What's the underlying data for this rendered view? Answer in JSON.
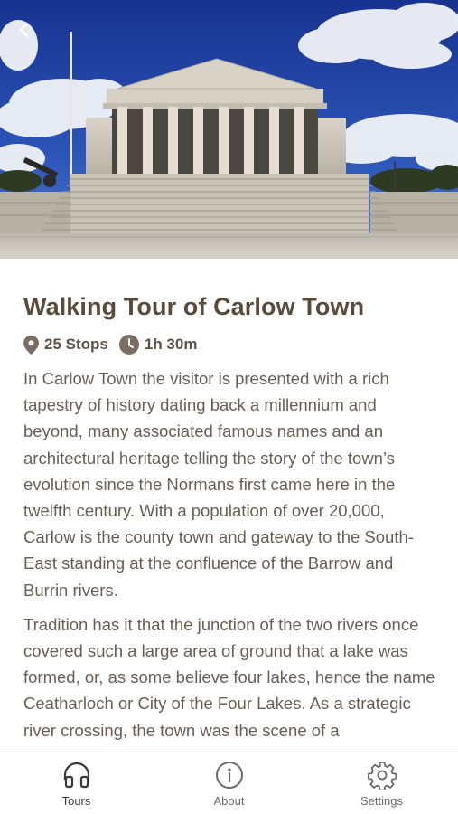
{
  "header": {
    "back_icon": "chevron-left-icon",
    "hero_image": "neoclassical-courthouse-photo"
  },
  "tour": {
    "title": "Walking Tour of Carlow Town",
    "stops": "25 Stops",
    "duration": "1h 30m",
    "stops_icon": "map-pin-icon",
    "duration_icon": "clock-icon",
    "paragraphs": [
      "In Carlow Town the visitor is presented with a rich tapestry of history dating back a millennium and beyond, many associated famous names and an architectural heritage telling the story of the town’s evolution since the Normans first came here in the twelfth century. With a population of over 20,000, Carlow is the county town and gateway to the South-East standing at the confluence of the Barrow and Burrin rivers.",
      "Tradition has it that the junction of the two rivers once covered such a large area of ground that a lake was formed, or, as some believe four lakes, hence the name Ceatharloch or City of the Four Lakes. As a strategic river crossing, the town was the scene of a"
    ]
  },
  "tabbar": {
    "tabs": [
      {
        "label": "Tours",
        "icon": "headphones-icon",
        "active": true
      },
      {
        "label": "About",
        "icon": "info-icon",
        "active": false
      },
      {
        "label": "Settings",
        "icon": "gear-icon",
        "active": false
      }
    ]
  },
  "colors": {
    "title": "#5a4a3a",
    "body_text": "#6a5e52",
    "icon": "#7a6e62",
    "sky": "#1f3f9e",
    "stone": "#c9c2b6"
  }
}
